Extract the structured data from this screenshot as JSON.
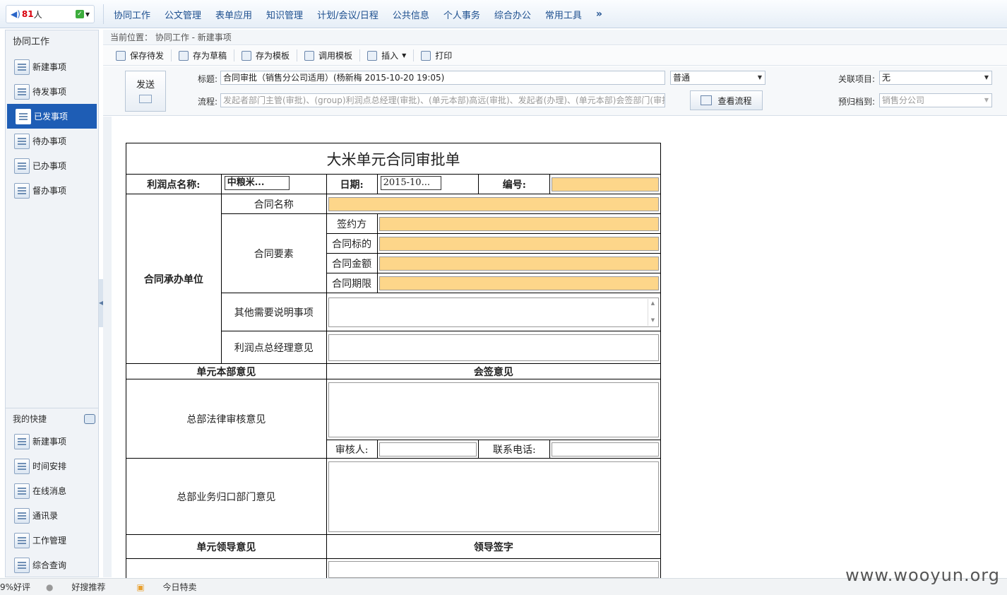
{
  "topbar": {
    "online_count": "81",
    "online_suffix": "人",
    "nav": [
      "协同工作",
      "公文管理",
      "表单应用",
      "知识管理",
      "计划/会议/日程",
      "公共信息",
      "个人事务",
      "综合办公",
      "常用工具"
    ],
    "more": "»"
  },
  "sidebar": {
    "title": "协同工作",
    "items": [
      {
        "label": "新建事项",
        "icon": "new-item-icon"
      },
      {
        "label": "待发事项",
        "icon": "pending-send-icon"
      },
      {
        "label": "已发事项",
        "icon": "sent-icon"
      },
      {
        "label": "待办事项",
        "icon": "todo-icon"
      },
      {
        "label": "已办事项",
        "icon": "done-icon"
      },
      {
        "label": "督办事项",
        "icon": "supervise-icon"
      }
    ],
    "quick_title": "我的快捷",
    "quick_items": [
      {
        "label": "新建事项",
        "icon": "new-item-icon"
      },
      {
        "label": "时间安排",
        "icon": "calendar-icon"
      },
      {
        "label": "在线消息",
        "icon": "message-icon"
      },
      {
        "label": "通讯录",
        "icon": "contacts-icon"
      },
      {
        "label": "工作管理",
        "icon": "work-manage-icon"
      },
      {
        "label": "综合查询",
        "icon": "query-icon"
      }
    ]
  },
  "breadcrumb": "当前位置：  协同工作  - 新建事项",
  "toolbar": [
    "保存待发",
    "存为草稿",
    "存为模板",
    "调用模板",
    "插入",
    "打印"
  ],
  "formhead": {
    "send": "发送",
    "title_label": "标题:",
    "title_value": "合同审批（销售分公司适用）(杨新梅  2015-10-20 19:05)",
    "priority": "普通",
    "related_label": "关联项目:",
    "related_value": "无",
    "flow_label": "流程:",
    "flow_value": "发起者部门主管(审批)、(group)利润点总经理(审批)、(单元本部)高远(审批)、发起者(办理)、(单元本部)会签部门(审批)",
    "view_flow": "查看流程",
    "archive_label": "预归档到:",
    "archive_value": "销售分公司"
  },
  "form": {
    "title": "大米单元合同审批单",
    "profit_label": "利润点名称:",
    "profit_value": "中粮米...",
    "date_label": "日期:",
    "date_value": "2015-10...",
    "no_label": "编号:",
    "unit_label": "合同承办单位",
    "contract_name": "合同名称",
    "elements": "合同要素",
    "party": "签约方",
    "subject": "合同标的",
    "amount": "合同金额",
    "term": "合同期限",
    "other": "其他需要说明事项",
    "gm_opinion": "利润点总经理意见",
    "unit_hq_opinion": "单元本部意见",
    "countersign": "会签意见",
    "legal": "总部法律审核意见",
    "reviewer": "审核人:",
    "phone": "联系电话:",
    "business": "总部业务归口部门意见",
    "leader_opinion": "单元领导意见",
    "leader_sign": "领导签字"
  },
  "statusbar": [
    "9%好评",
    "好搜推荐",
    "今日特卖"
  ],
  "watermark": "www.wooyun.org"
}
